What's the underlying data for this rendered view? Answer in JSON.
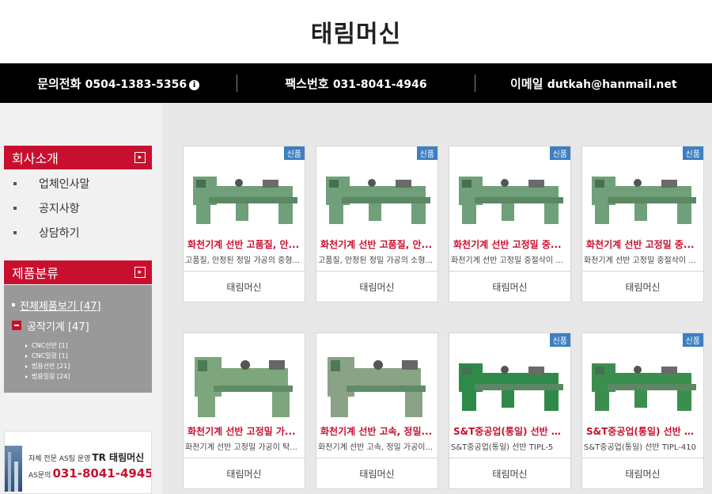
{
  "site": {
    "title": "태림머신"
  },
  "contact": {
    "phone_label": "문의전화",
    "phone": "0504-1383-5356",
    "fax_label": "팩스번호",
    "fax": "031-8041-4946",
    "email_label": "이메일",
    "email": "dutkah@hanmail.net"
  },
  "sidebar": {
    "about_title": "회사소개",
    "about_items": [
      "업체인사말",
      "공지사항",
      "상담하기"
    ],
    "category_title": "제품분류",
    "all_products": "전체제품보기 [47]",
    "machine_tools": "공작기계 [47]",
    "sub_items": [
      "CNC선반 [1]",
      "CNC밀링 [1]",
      "범용선반 [21]",
      "범용밀링 [24]"
    ]
  },
  "banner": {
    "line1": "자체 전문 AS팀 운영",
    "brand": "TR 태림머신",
    "as_label": "AS문의",
    "as_phone": "031-8041-4945"
  },
  "products": [
    {
      "badge": "신품",
      "name": "화천기계 선반 고품질, 안...",
      "desc": "고품질, 안정된 정밀 가공의 중형...",
      "seller": "태림머신",
      "machine_color": "#6fa07a"
    },
    {
      "badge": "신품",
      "name": "화천기계 선반 고품질, 안...",
      "desc": "고품질, 안정된 정밀 가공의 소형...",
      "seller": "태림머신",
      "machine_color": "#6fa07a"
    },
    {
      "badge": "신품",
      "name": "화천기계 선반 고정밀 중...",
      "desc": "화천기계 선반 고정밀 중절삭이 ...",
      "seller": "태림머신",
      "machine_color": "#6fa07a"
    },
    {
      "badge": "신품",
      "name": "화천기계 선반 고정밀 중...",
      "desc": "화천기계 선반 고정밀 중절삭이 ...",
      "seller": "태림머신",
      "machine_color": "#6fa07a"
    },
    {
      "badge": "",
      "name": "화천기계 선반 고정밀 가...",
      "desc": "화천기계 선반 고정밀 가공이 탁...",
      "seller": "태림머신",
      "machine_color": "#7ea67c"
    },
    {
      "badge": "",
      "name": "화천기계 선반 고속, 정밀...",
      "desc": "화천기계 선반 고속, 정밀 가공이...",
      "seller": "태림머신",
      "machine_color": "#8aa386"
    },
    {
      "badge": "신품",
      "name": "S&T중공업(통일) 선반 TI...",
      "desc": "S&T중공업(통일) 선반 TIPL-5",
      "seller": "태림머신",
      "machine_color": "#2f8a4a"
    },
    {
      "badge": "신품",
      "name": "S&T중공업(통일) 선반 TI...",
      "desc": "S&T중공업(통일) 선반 TIPL-410",
      "seller": "태림머신",
      "machine_color": "#3b8f4e"
    }
  ],
  "colors": {
    "accent": "#c8102e",
    "badge": "#3d7fc1",
    "header_bg": "#000000"
  }
}
